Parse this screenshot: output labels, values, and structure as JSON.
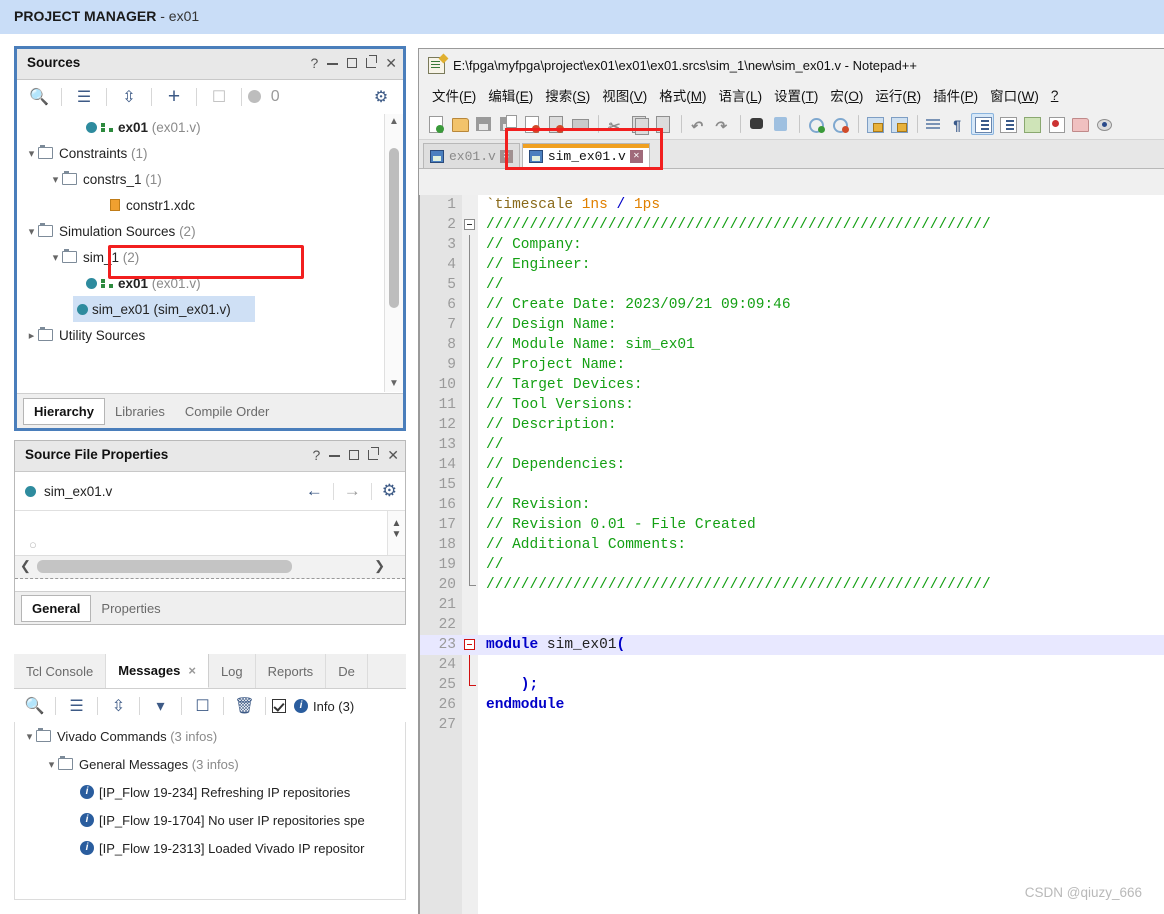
{
  "vivado": {
    "banner": {
      "app": "PROJECT MANAGER",
      "project": "- ex01"
    },
    "sources_panel": {
      "title": "Sources",
      "window_buttons": [
        "?",
        "minimize",
        "maximize",
        "float",
        "close"
      ],
      "toolbar": {
        "search": "search-icon",
        "collapse_all": "collapse-all-icon",
        "expand_all": "expand-all-icon",
        "add_sources": "plus-icon",
        "help_file": "file-question-icon",
        "badge_count": "0",
        "settings": "gear-icon"
      },
      "tree": [
        {
          "indent": 2,
          "chev": "",
          "icon": "module",
          "label": "ex01",
          "suffix": "(ex01.v)",
          "bold": true,
          "selected": false
        },
        {
          "indent": 0,
          "chev": "v",
          "icon": "folder",
          "label": "Constraints",
          "suffix": "(1)",
          "bold": false,
          "selected": false
        },
        {
          "indent": 1,
          "chev": "v",
          "icon": "folder",
          "label": "constrs_1",
          "suffix": "(1)",
          "bold": false,
          "selected": false
        },
        {
          "indent": 3,
          "chev": "",
          "icon": "xdc",
          "label": "constr1.xdc",
          "suffix": "",
          "bold": false,
          "selected": false
        },
        {
          "indent": 0,
          "chev": "v",
          "icon": "folder",
          "label": "Simulation Sources",
          "suffix": "(2)",
          "bold": false,
          "selected": false
        },
        {
          "indent": 1,
          "chev": "v",
          "icon": "folder",
          "label": "sim_1",
          "suffix": "(2)",
          "bold": false,
          "selected": false
        },
        {
          "indent": 2,
          "chev": "",
          "icon": "module",
          "label": "ex01",
          "suffix": "(ex01.v)",
          "bold": true,
          "selected": false
        },
        {
          "indent": 2,
          "chev": "",
          "icon": "dot",
          "label": "sim_ex01 (sim_ex01.v)",
          "suffix": "",
          "bold": false,
          "selected": true
        },
        {
          "indent": 0,
          "chev": ">",
          "icon": "folder",
          "label": "Utility Sources",
          "suffix": "",
          "bold": false,
          "selected": false
        }
      ],
      "tabs": [
        {
          "label": "Hierarchy",
          "active": true
        },
        {
          "label": "Libraries",
          "active": false
        },
        {
          "label": "Compile Order",
          "active": false
        }
      ]
    },
    "source_file_properties": {
      "title": "Source File Properties",
      "file_name": "sim_ex01.v",
      "nav": {
        "back": "back-arrow-icon",
        "forward": "forward-arrow-icon",
        "settings": "gear-icon"
      },
      "tabs": [
        {
          "label": "General",
          "active": true
        },
        {
          "label": "Properties",
          "active": false
        }
      ]
    },
    "console": {
      "tabs": [
        {
          "label": "Tcl Console",
          "active": false,
          "closable": false
        },
        {
          "label": "Messages",
          "active": true,
          "closable": true
        },
        {
          "label": "Log",
          "active": false,
          "closable": false
        },
        {
          "label": "Reports",
          "active": false,
          "closable": false
        },
        {
          "label": "De",
          "active": false,
          "closable": false
        }
      ],
      "toolbar": {
        "search": "search-icon",
        "collapse_all": "collapse-all-icon",
        "expand_all": "expand-all-icon",
        "filter": "filter-icon",
        "comment": "comment-icon",
        "delete": "trash-icon",
        "info_filter_label": "Info (3)"
      },
      "tree": [
        {
          "indent": 0,
          "chev": "v",
          "icon": "folder",
          "label": "Vivado Commands",
          "suffix": "(3 infos)"
        },
        {
          "indent": 1,
          "chev": "v",
          "icon": "folder",
          "label": "General Messages",
          "suffix": "(3 infos)"
        },
        {
          "indent": 2,
          "chev": "",
          "icon": "info",
          "label": "[IP_Flow 19-234] Refreshing IP repositories",
          "suffix": ""
        },
        {
          "indent": 2,
          "chev": "",
          "icon": "info",
          "label": "[IP_Flow 19-1704] No user IP repositories spe",
          "suffix": ""
        },
        {
          "indent": 2,
          "chev": "",
          "icon": "info",
          "label": "[IP_Flow 19-2313] Loaded Vivado IP repositor",
          "suffix": ""
        }
      ]
    }
  },
  "notepad": {
    "title": "E:\\fpga\\myfpga\\project\\ex01\\ex01\\ex01.srcs\\sim_1\\new\\sim_ex01.v - Notepad++",
    "menu": [
      {
        "text": "文件(F)",
        "mnemonic": "F"
      },
      {
        "text": "编辑(E)",
        "mnemonic": "E"
      },
      {
        "text": "搜索(S)",
        "mnemonic": "S"
      },
      {
        "text": "视图(V)",
        "mnemonic": "V"
      },
      {
        "text": "格式(M)",
        "mnemonic": "M"
      },
      {
        "text": "语言(L)",
        "mnemonic": "L"
      },
      {
        "text": "设置(T)",
        "mnemonic": "T"
      },
      {
        "text": "宏(O)",
        "mnemonic": "O"
      },
      {
        "text": "运行(R)",
        "mnemonic": "R"
      },
      {
        "text": "插件(P)",
        "mnemonic": "P"
      },
      {
        "text": "窗口(W)",
        "mnemonic": "W"
      },
      {
        "text": "?",
        "mnemonic": ""
      }
    ],
    "toolbar_icons": [
      "new-file-icon",
      "open-file-icon",
      "save-icon",
      "save-all-icon",
      "close-file-icon",
      "close-all-icon",
      "print-icon",
      "sep",
      "cut-icon",
      "copy-icon",
      "paste-icon",
      "sep",
      "undo-icon",
      "redo-icon",
      "sep",
      "find-icon",
      "replace-icon",
      "sep",
      "zoom-in-icon",
      "zoom-out-icon",
      "sep",
      "sync-vertical-icon",
      "sync-horizontal-icon",
      "sep",
      "word-wrap-icon",
      "show-all-chars-icon",
      "doc-list-icon",
      "function-list-icon",
      "document-map-icon",
      "macro-record-icon",
      "folder-as-workspace-icon",
      "preview-icon"
    ],
    "tabs": [
      {
        "label": "ex01.v",
        "active": false
      },
      {
        "label": "sim_ex01.v",
        "active": true
      }
    ],
    "code": [
      {
        "n": "1",
        "fold": "none",
        "segs": [
          {
            "t": "`timescale ",
            "c": "c-dir"
          },
          {
            "t": "1ns",
            "c": "c-num"
          },
          {
            "t": " / ",
            "c": "c-op"
          },
          {
            "t": "1ps",
            "c": "c-num"
          }
        ]
      },
      {
        "n": "2",
        "fold": "start",
        "segs": [
          {
            "t": "//////////////////////////////////////////////////////////",
            "c": "c-comment"
          }
        ]
      },
      {
        "n": "3",
        "fold": "bar",
        "segs": [
          {
            "t": "// Company: ",
            "c": "c-comment"
          }
        ]
      },
      {
        "n": "4",
        "fold": "bar",
        "segs": [
          {
            "t": "// Engineer: ",
            "c": "c-comment"
          }
        ]
      },
      {
        "n": "5",
        "fold": "bar",
        "segs": [
          {
            "t": "// ",
            "c": "c-comment"
          }
        ]
      },
      {
        "n": "6",
        "fold": "bar",
        "segs": [
          {
            "t": "// Create Date: 2023/09/21 09:09:46",
            "c": "c-comment"
          }
        ]
      },
      {
        "n": "7",
        "fold": "bar",
        "segs": [
          {
            "t": "// Design Name: ",
            "c": "c-comment"
          }
        ]
      },
      {
        "n": "8",
        "fold": "bar",
        "segs": [
          {
            "t": "// Module Name: sim_ex01",
            "c": "c-comment"
          }
        ]
      },
      {
        "n": "9",
        "fold": "bar",
        "segs": [
          {
            "t": "// Project Name: ",
            "c": "c-comment"
          }
        ]
      },
      {
        "n": "10",
        "fold": "bar",
        "segs": [
          {
            "t": "// Target Devices: ",
            "c": "c-comment"
          }
        ]
      },
      {
        "n": "11",
        "fold": "bar",
        "segs": [
          {
            "t": "// Tool Versions: ",
            "c": "c-comment"
          }
        ]
      },
      {
        "n": "12",
        "fold": "bar",
        "segs": [
          {
            "t": "// Description: ",
            "c": "c-comment"
          }
        ]
      },
      {
        "n": "13",
        "fold": "bar",
        "segs": [
          {
            "t": "// ",
            "c": "c-comment"
          }
        ]
      },
      {
        "n": "14",
        "fold": "bar",
        "segs": [
          {
            "t": "// Dependencies: ",
            "c": "c-comment"
          }
        ]
      },
      {
        "n": "15",
        "fold": "bar",
        "segs": [
          {
            "t": "// ",
            "c": "c-comment"
          }
        ]
      },
      {
        "n": "16",
        "fold": "bar",
        "segs": [
          {
            "t": "// Revision:",
            "c": "c-comment"
          }
        ]
      },
      {
        "n": "17",
        "fold": "bar",
        "segs": [
          {
            "t": "// Revision 0.01 - File Created",
            "c": "c-comment"
          }
        ]
      },
      {
        "n": "18",
        "fold": "bar",
        "segs": [
          {
            "t": "// Additional Comments:",
            "c": "c-comment"
          }
        ]
      },
      {
        "n": "19",
        "fold": "bar",
        "segs": [
          {
            "t": "// ",
            "c": "c-comment"
          }
        ]
      },
      {
        "n": "20",
        "fold": "end",
        "segs": [
          {
            "t": "//////////////////////////////////////////////////////////",
            "c": "c-comment"
          }
        ]
      },
      {
        "n": "21",
        "fold": "none",
        "segs": []
      },
      {
        "n": "22",
        "fold": "none",
        "segs": []
      },
      {
        "n": "23",
        "fold": "start-red",
        "hl": true,
        "segs": [
          {
            "t": "module ",
            "c": "c-kw"
          },
          {
            "t": "sim_ex01",
            "c": "c-plain"
          },
          {
            "t": "(",
            "c": "c-kw"
          }
        ]
      },
      {
        "n": "24",
        "fold": "bar-red",
        "segs": []
      },
      {
        "n": "25",
        "fold": "end-red",
        "segs": [
          {
            "t": "    );",
            "c": "c-kw"
          }
        ]
      },
      {
        "n": "26",
        "fold": "none",
        "segs": [
          {
            "t": "endmodule",
            "c": "c-kw"
          }
        ]
      },
      {
        "n": "27",
        "fold": "none",
        "segs": []
      }
    ]
  },
  "watermark": "CSDN @qiuzy_666",
  "colors": {
    "banner_bg": "#c9ddf7",
    "panel_focus_border": "#4a7ebb",
    "highlight_red": "#f21f1f",
    "selection_blue": "#cfe0f5",
    "comment_green": "#14a014",
    "keyword_blue": "#0000c8",
    "teal_dot": "#2e8b9e",
    "tab_orange": "#f0a020"
  }
}
